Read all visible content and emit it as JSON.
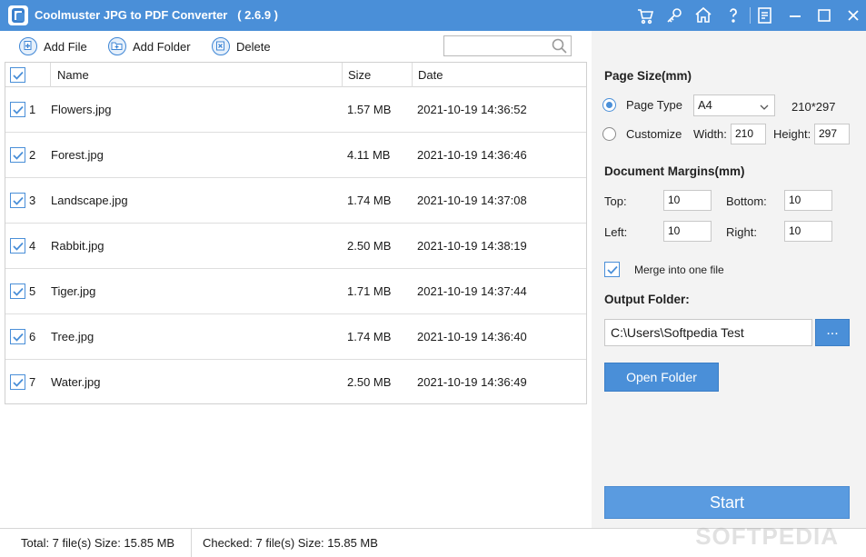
{
  "window": {
    "title": "Coolmuster JPG to PDF Converter   ( 2.6.9 )",
    "accent": "#4a8fd8"
  },
  "titlebar_icons": [
    "cart-icon",
    "key-icon",
    "home-icon",
    "help-icon",
    "feedback-icon",
    "minimize-icon",
    "maximize-icon",
    "close-icon"
  ],
  "toolbar": {
    "add_file": "Add File",
    "add_folder": "Add Folder",
    "delete": "Delete",
    "search_value": ""
  },
  "table": {
    "headers": {
      "name": "Name",
      "size": "Size",
      "date": "Date"
    },
    "all_checked": true,
    "rows": [
      {
        "index": "1",
        "name": "Flowers.jpg",
        "size": "1.57 MB",
        "date": "2021-10-19 14:36:52",
        "checked": true
      },
      {
        "index": "2",
        "name": "Forest.jpg",
        "size": "4.11 MB",
        "date": "2021-10-19 14:36:46",
        "checked": true
      },
      {
        "index": "3",
        "name": "Landscape.jpg",
        "size": "1.74 MB",
        "date": "2021-10-19 14:37:08",
        "checked": true
      },
      {
        "index": "4",
        "name": "Rabbit.jpg",
        "size": "2.50 MB",
        "date": "2021-10-19 14:38:19",
        "checked": true
      },
      {
        "index": "5",
        "name": "Tiger.jpg",
        "size": "1.71 MB",
        "date": "2021-10-19 14:37:44",
        "checked": true
      },
      {
        "index": "6",
        "name": "Tree.jpg",
        "size": "1.74 MB",
        "date": "2021-10-19 14:36:40",
        "checked": true
      },
      {
        "index": "7",
        "name": "Water.jpg",
        "size": "2.50 MB",
        "date": "2021-10-19 14:36:49",
        "checked": true
      }
    ]
  },
  "settings": {
    "page_size_title": "Page Size(mm)",
    "page_type_label": "Page Type",
    "page_type_value": "A4",
    "page_type_dims": "210*297",
    "customize_label": "Customize",
    "width_label": "Width:",
    "width_value": "210",
    "height_label": "Height:",
    "height_value": "297",
    "margins_title": "Document Margins(mm)",
    "top_label": "Top:",
    "top_value": "10",
    "bottom_label": "Bottom:",
    "bottom_value": "10",
    "left_label": "Left:",
    "left_value": "10",
    "right_label": "Right:",
    "right_value": "10",
    "merge_label": "Merge into one file",
    "merge_checked": true,
    "output_title": "Output Folder:",
    "output_path": "C:\\Users\\Softpedia Test",
    "browse_label": "...",
    "open_folder_label": "Open Folder",
    "start_label": "Start"
  },
  "status": {
    "total": "Total: 7 file(s) Size: 15.85 MB",
    "checked": "Checked: 7 file(s) Size: 15.85 MB"
  },
  "watermark": "SOFTPEDIA"
}
